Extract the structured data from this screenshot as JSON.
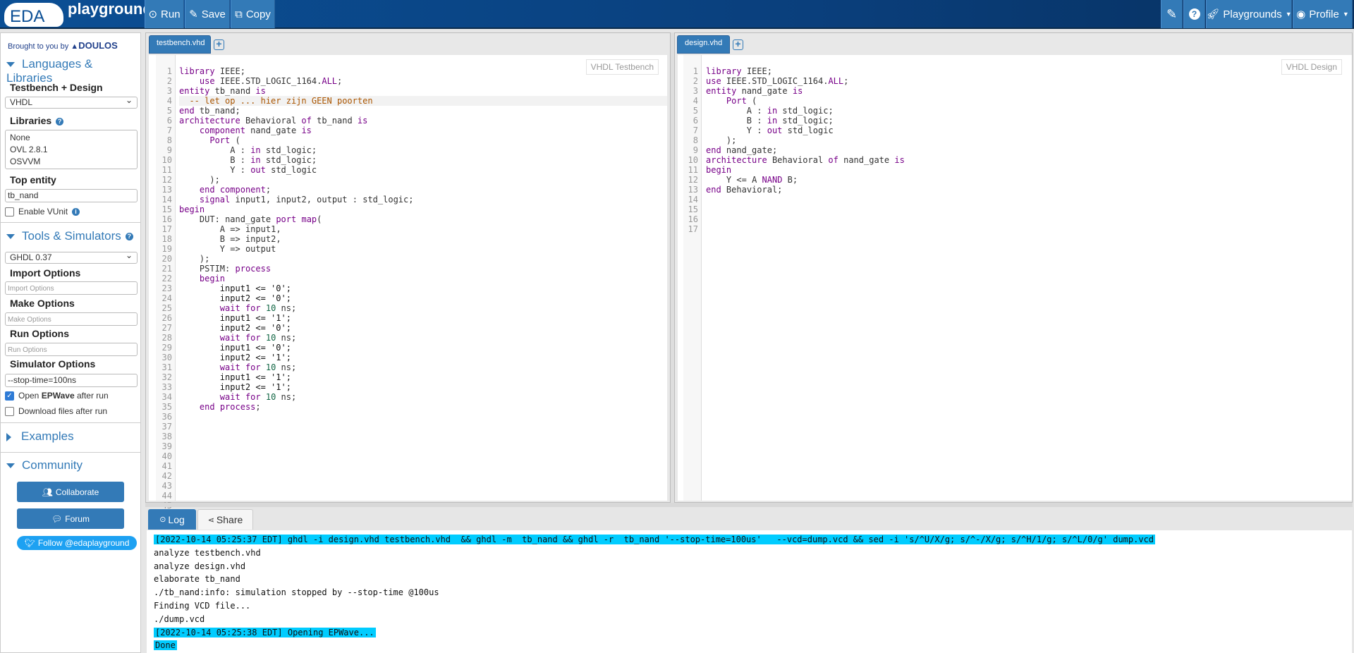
{
  "header": {
    "logo_eda": "EDA",
    "logo_playground": "playground",
    "run": "Run",
    "save": "Save",
    "copy": "Copy",
    "playgrounds": "Playgrounds",
    "profile": "Profile"
  },
  "sidebar": {
    "brought_by": "Brought to you by",
    "doulos": "DOULOS",
    "languages_title": "Languages & Libraries",
    "tb_design_label": "Testbench + Design",
    "language": "VHDL",
    "libraries_label": "Libraries",
    "libraries": [
      "None",
      "OVL 2.8.1",
      "OSVVM"
    ],
    "top_entity_label": "Top entity",
    "top_entity": "tb_nand",
    "enable_vunit": "Enable VUnit",
    "tools_title": "Tools & Simulators",
    "simulator": "GHDL 0.37",
    "import_label": "Import Options",
    "import_ph": "Import Options",
    "make_label": "Make Options",
    "make_ph": "Make Options",
    "run_label": "Run Options",
    "run_ph": "Run Options",
    "sim_label": "Simulator Options",
    "sim_value": "--stop-time=100ns",
    "open_epwave_pre": "Open ",
    "open_epwave_bold": "EPWave",
    "open_epwave_post": " after run",
    "open_epwave_checked": true,
    "download_files": "Download files after run",
    "download_checked": false,
    "examples": "Examples",
    "community": "Community",
    "collaborate": "Collaborate",
    "forum": "Forum",
    "follow": "Follow @edaplayground"
  },
  "testbench": {
    "tab": "testbench.vhd",
    "mode": "VHDL Testbench",
    "lines": [
      "library IEEE;",
      "    use IEEE.STD_LOGIC_1164.ALL;",
      "",
      "entity tb_nand is",
      "  -- let op ... hier zijn GEEN poorten",
      "end tb_nand;",
      "",
      "architecture Behavioral of tb_nand is",
      "    component nand_gate is",
      "      Port (",
      "          A : in std_logic;",
      "          B : in std_logic;",
      "          Y : out std_logic",
      "      );",
      "    end component;",
      "",
      "    signal input1, input2, output : std_logic;",
      "",
      "begin",
      "    DUT: nand_gate port map(",
      "        A => input1,",
      "        B => input2,",
      "        Y => output",
      "    );",
      "",
      "    PSTIM: process",
      "    begin",
      "        input1 <= '0';",
      "        input2 <= '0';",
      "        wait for 10 ns;",
      "",
      "        input1 <= '1';",
      "        input2 <= '0';",
      "        wait for 10 ns;",
      "",
      "        input1 <= '0';",
      "        input2 <= '1';",
      "        wait for 10 ns;",
      "",
      "        input1 <= '1';",
      "        input2 <= '1';",
      "        wait for 10 ns;",
      "",
      "    end process;",
      ""
    ]
  },
  "design": {
    "tab": "design.vhd",
    "mode": "VHDL Design",
    "lines": [
      "library IEEE;",
      "use IEEE.STD_LOGIC_1164.ALL;",
      "",
      "entity nand_gate is",
      "    Port (",
      "        A : in std_logic;",
      "        B : in std_logic;",
      "        Y : out std_logic",
      "    );",
      "end nand_gate;",
      "",
      "architecture Behavioral of nand_gate is",
      "begin",
      "",
      "    Y <= A NAND B;",
      "",
      "end Behavioral;"
    ]
  },
  "log": {
    "tab_log": "Log",
    "tab_share": "Share",
    "lines": [
      {
        "text": "[2022-10-14 05:25:37 EDT] ghdl -i design.vhd testbench.vhd  && ghdl -m  tb_nand && ghdl -r  tb_nand '--stop-time=100us'   --vcd=dump.vcd && sed -i 's/^U/X/g; s/^-/X/g; s/^H/1/g; s/^L/0/g' dump.vcd",
        "hl": true
      },
      {
        "text": "analyze testbench.vhd",
        "hl": false
      },
      {
        "text": "analyze design.vhd",
        "hl": false
      },
      {
        "text": "elaborate tb_nand",
        "hl": false
      },
      {
        "text": "./tb_nand:info: simulation stopped by --stop-time @100us",
        "hl": false
      },
      {
        "text": "Finding VCD file...",
        "hl": false
      },
      {
        "text": "./dump.vcd",
        "hl": false
      },
      {
        "text": "[2022-10-14 05:25:38 EDT] Opening EPWave...",
        "hl": true
      },
      {
        "text": "Done",
        "hl": true
      }
    ]
  },
  "colors": {
    "accent": "#337ab7",
    "log_highlight": "#00ccff",
    "keyword": "#770088",
    "string": "#228811",
    "comment": "#aa5500"
  }
}
